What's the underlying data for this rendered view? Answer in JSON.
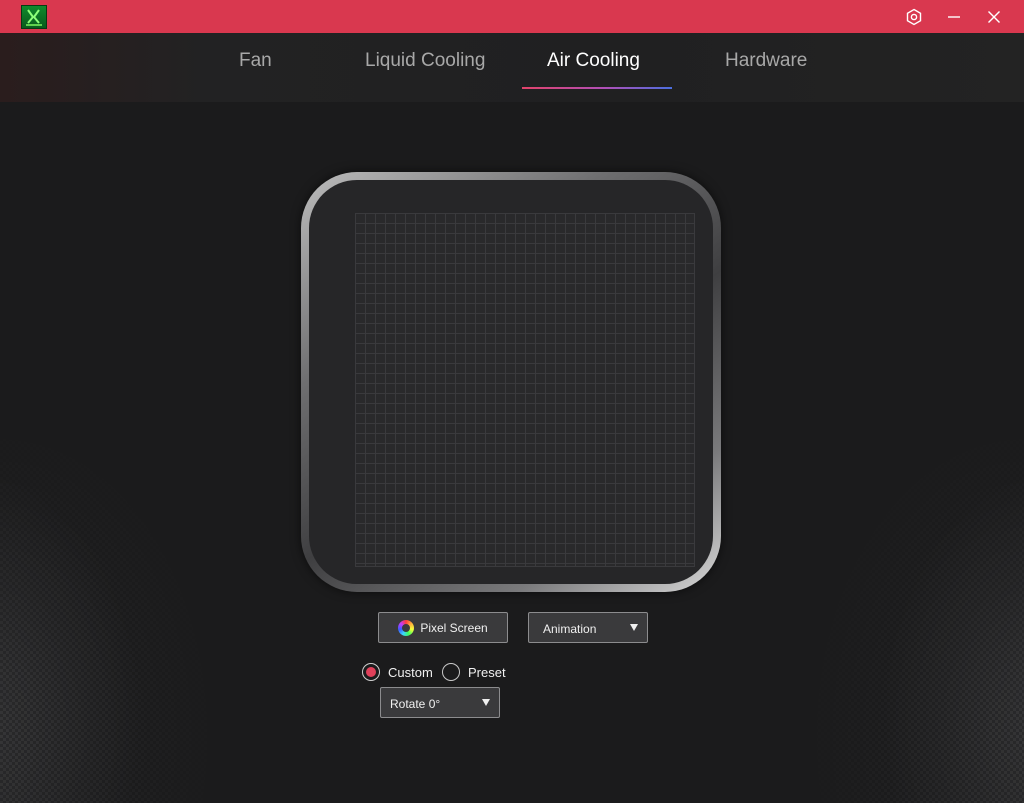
{
  "window": {
    "accent_color": "#d9384f"
  },
  "titlebar": {
    "logo_icon": "app-logo-icon",
    "settings_icon": "settings-hex-icon",
    "minimize_icon": "minimize-icon",
    "close_icon": "close-icon"
  },
  "tabs": [
    {
      "label": "Fan",
      "active": false
    },
    {
      "label": "Liquid Cooling",
      "active": false
    },
    {
      "label": "Air Cooling",
      "active": true
    },
    {
      "label": "Hardware",
      "active": false
    }
  ],
  "preview": {
    "grid_icon": "pixel-grid"
  },
  "controls": {
    "pixel_screen_label": "Pixel Screen",
    "animation_select": "Animation",
    "mode_options": [
      {
        "label": "Custom",
        "selected": true
      },
      {
        "label": "Preset",
        "selected": false
      }
    ],
    "rotate_select": "Rotate 0°"
  }
}
